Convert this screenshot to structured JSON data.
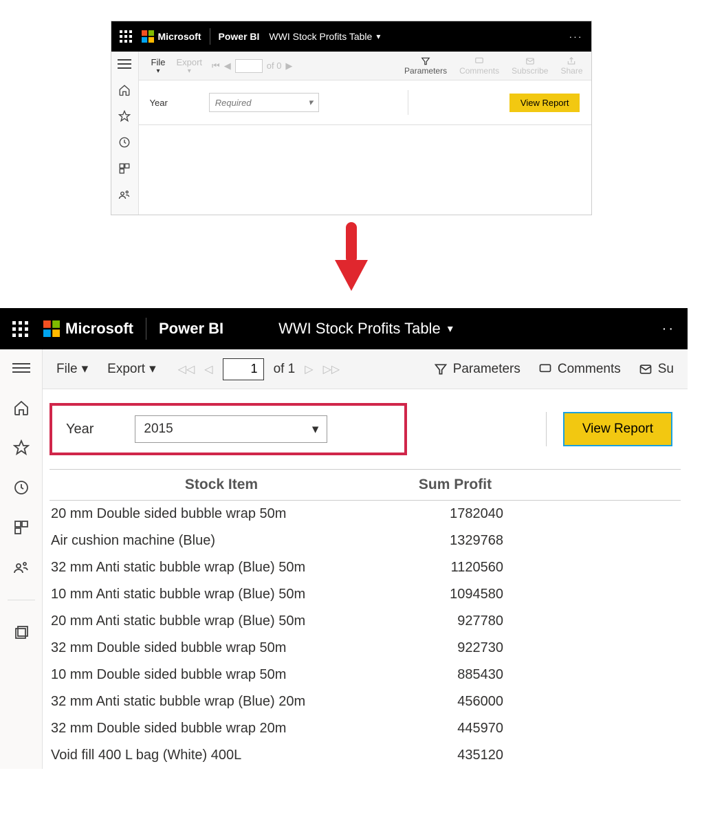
{
  "top": {
    "brand": "Microsoft",
    "product": "Power BI",
    "report_title": "WWI Stock Profits Table",
    "toolbar": {
      "file": "File",
      "export": "Export",
      "page_of": "of 0",
      "parameters": "Parameters",
      "comments": "Comments",
      "subscribe": "Subscribe",
      "share": "Share"
    },
    "param": {
      "year_label": "Year",
      "year_placeholder": "Required",
      "view_report": "View Report"
    }
  },
  "bottom": {
    "brand": "Microsoft",
    "product": "Power BI",
    "report_title": "WWI Stock Profits Table",
    "toolbar": {
      "file": "File",
      "export": "Export",
      "page_current": "1",
      "page_of": "of 1",
      "parameters": "Parameters",
      "comments": "Comments",
      "subscribe_abbrev": "Su"
    },
    "param": {
      "year_label": "Year",
      "year_value": "2015",
      "view_report": "View Report"
    },
    "table": {
      "col_item": "Stock Item",
      "col_profit": "Sum Profit",
      "rows": [
        {
          "item": "20 mm Double sided bubble wrap 50m",
          "profit": "1782040"
        },
        {
          "item": "Air cushion machine (Blue)",
          "profit": "1329768"
        },
        {
          "item": "32 mm Anti static bubble wrap (Blue) 50m",
          "profit": "1120560"
        },
        {
          "item": "10 mm Anti static bubble wrap (Blue) 50m",
          "profit": "1094580"
        },
        {
          "item": "20 mm Anti static bubble wrap (Blue) 50m",
          "profit": "927780"
        },
        {
          "item": "32 mm Double sided bubble wrap 50m",
          "profit": "922730"
        },
        {
          "item": "10 mm Double sided bubble wrap 50m",
          "profit": "885430"
        },
        {
          "item": "32 mm Anti static bubble wrap (Blue) 20m",
          "profit": "456000"
        },
        {
          "item": "32 mm Double sided bubble wrap 20m",
          "profit": "445970"
        },
        {
          "item": "Void fill 400 L bag (White) 400L",
          "profit": "435120"
        }
      ]
    }
  }
}
